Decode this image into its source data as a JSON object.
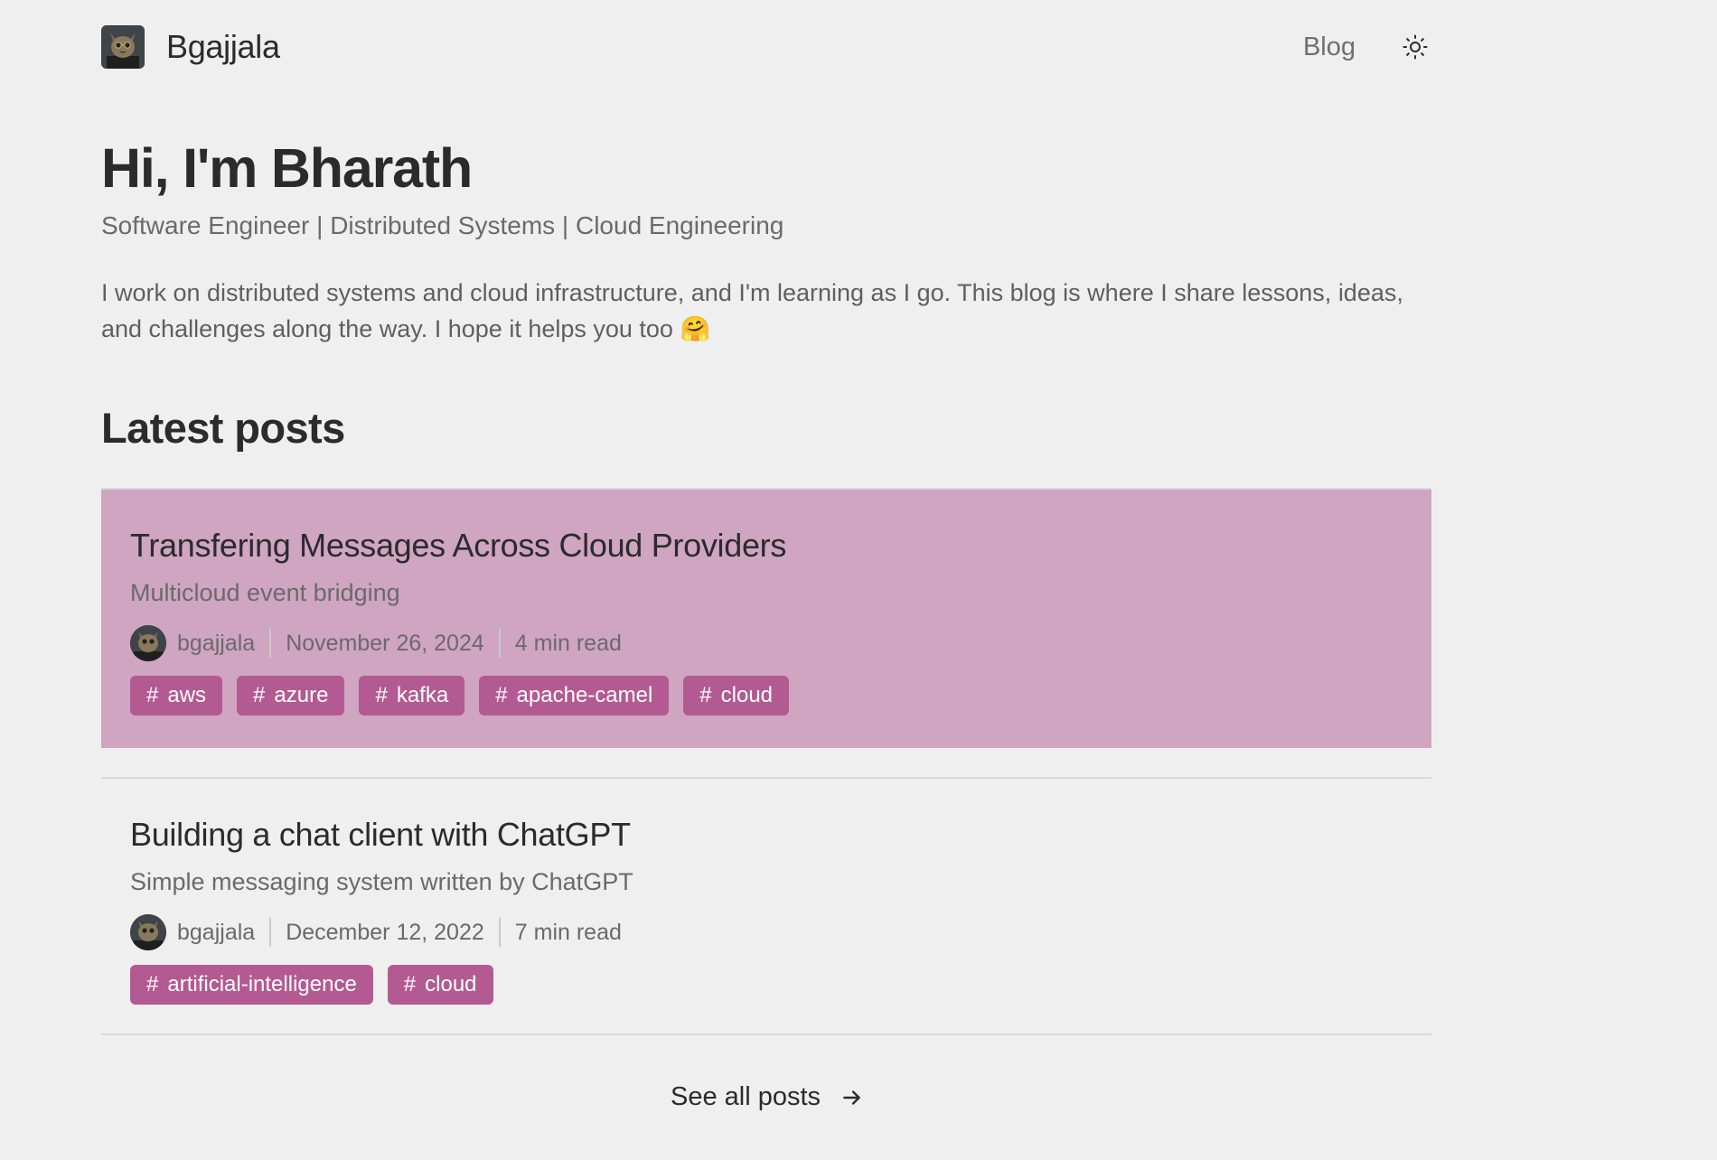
{
  "header": {
    "site_name": "Bgajjala",
    "nav_blog": "Blog",
    "theme_icon": "sun-icon"
  },
  "hero": {
    "title": "Hi, I'm Bharath",
    "subtitle": "Software Engineer | Distributed Systems | Cloud Engineering",
    "description": "I work on distributed systems and cloud infrastructure, and I'm learning as I go. This blog is where I share lessons, ideas, and challenges along the way. I hope it helps you too 🤗"
  },
  "latest": {
    "heading": "Latest posts",
    "posts": [
      {
        "title": "Transfering Messages Across Cloud Providers",
        "description": "Multicloud event bridging",
        "author": "bgajjala",
        "date": "November 26, 2024",
        "read_time": "4 min read",
        "tags": [
          "aws",
          "azure",
          "kafka",
          "apache-camel",
          "cloud"
        ]
      },
      {
        "title": "Building a chat client with ChatGPT",
        "description": "Simple messaging system written by ChatGPT",
        "author": "bgajjala",
        "date": "December 12, 2022",
        "read_time": "7 min read",
        "tags": [
          "artificial-intelligence",
          "cloud"
        ]
      }
    ]
  },
  "footer": {
    "see_all": "See all posts",
    "arrow_icon": "arrow-right-icon"
  },
  "colors": {
    "background": "#efefef",
    "highlight_card": "#cfa5c2",
    "tag": "#b35a92",
    "text": "#2b2b2b",
    "muted_text": "#6a6a6a"
  }
}
